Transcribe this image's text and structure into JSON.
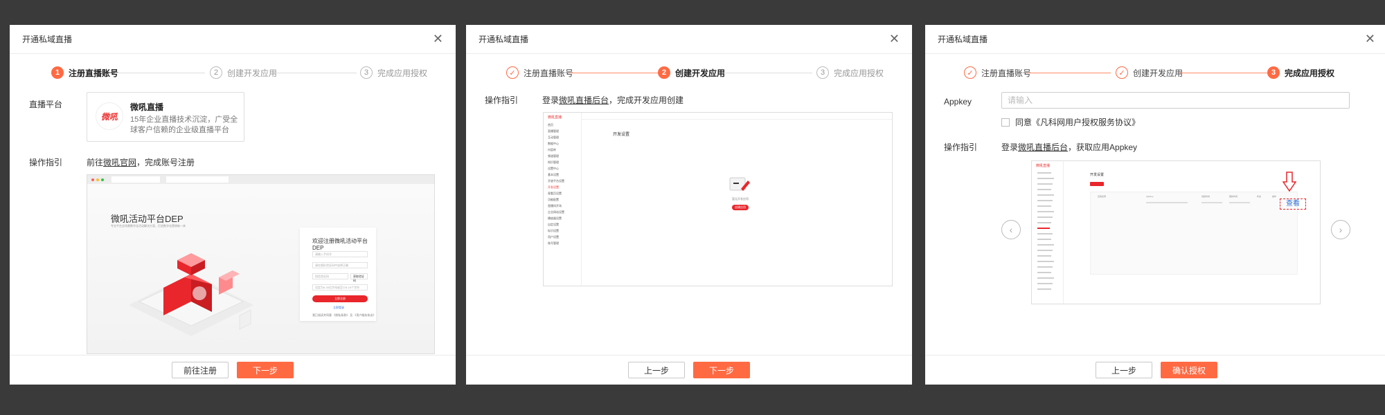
{
  "dialog1": {
    "title": "开通私域直播",
    "steps": [
      {
        "num": "1",
        "label": "注册直播账号"
      },
      {
        "num": "2",
        "label": "创建开发应用"
      },
      {
        "num": "3",
        "label": "完成应用授权"
      }
    ],
    "platform_label": "直播平台",
    "platform": {
      "logo_text": "微吼",
      "name": "微吼直播",
      "desc": "15年企业直播技术沉淀，广受全球客户信赖的企业级直播平台"
    },
    "guide_label": "操作指引",
    "guide_prefix": "前往",
    "guide_link": "微吼官网",
    "guide_suffix": "，完成账号注册",
    "screenshot": {
      "hero_title": "微吼活动平台DEP",
      "hero_sub": "专业平台全场景数字化活动解决方案，打造数字化营销新一体",
      "login_title": "欢迎注册微吼活动平台DEP",
      "ph_phone": "请输入手机号",
      "ph_code": "请在图形验证码中选择正确",
      "ph_sms": "短信验证码",
      "sms_btn": "获取验证码",
      "ph_password": "设定为6-30位字母或至少8-16个字符",
      "submit": "立即注册",
      "login_link": "立即登录",
      "terms": "我已阅读并同意 《隐私条款》 及 《用户服务协议》"
    },
    "buttons": {
      "secondary": "前往注册",
      "primary": "下一步"
    }
  },
  "dialog2": {
    "title": "开通私域直播",
    "steps": [
      {
        "num": "✓",
        "label": "注册直播账号"
      },
      {
        "num": "2",
        "label": "创建开发应用"
      },
      {
        "num": "3",
        "label": "完成应用授权"
      }
    ],
    "guide_label": "操作指引",
    "guide_prefix": "登录",
    "guide_link": "微吼直播后台",
    "guide_suffix": "，完成开发应用创建",
    "screenshot": {
      "logo": "微吼直播",
      "menu": [
        "首页",
        "直播管理",
        "互动管理",
        "数据中心",
        "内容库",
        "频道管理",
        "知识管理",
        "设置中心",
        "基本设置",
        "开放平台设置",
        "开发设置",
        "观看页设置",
        "功能配置",
        "直播间开场",
        "企业网站设置",
        "播放器设置",
        "自定设置",
        "标识设置",
        "用户设置",
        "账号管理"
      ],
      "page_title": "开发设置",
      "empty_text": "暂无开发应用",
      "create_btn": "创建应用"
    },
    "buttons": {
      "secondary": "上一步",
      "primary": "下一步"
    }
  },
  "dialog3": {
    "title": "开通私域直播",
    "steps": [
      {
        "num": "✓",
        "label": "注册直播账号"
      },
      {
        "num": "✓",
        "label": "创建开发应用"
      },
      {
        "num": "3",
        "label": "完成应用授权"
      }
    ],
    "appkey_label": "Appkey",
    "appkey_placeholder": "请输入",
    "agree_text": "同意《凡科网用户授权服务协议》",
    "guide_label": "操作指引",
    "guide_prefix": "登录",
    "guide_link": "微吼直播后台",
    "guide_suffix": "，获取应用Appkey",
    "screenshot": {
      "logo": "微吼直播",
      "page_title": "开发设置",
      "view_label": "查看",
      "table_headers": [
        "应用名称",
        "AppKey",
        "创建时间",
        "更新时间",
        "状态",
        "操作"
      ]
    },
    "buttons": {
      "secondary": "上一步",
      "primary": "确认授权"
    },
    "prev_icon": "chevron-left-icon",
    "next_icon": "chevron-right-icon"
  },
  "colors": {
    "accent": "#ff6a43",
    "brand_red": "#e8262b"
  }
}
